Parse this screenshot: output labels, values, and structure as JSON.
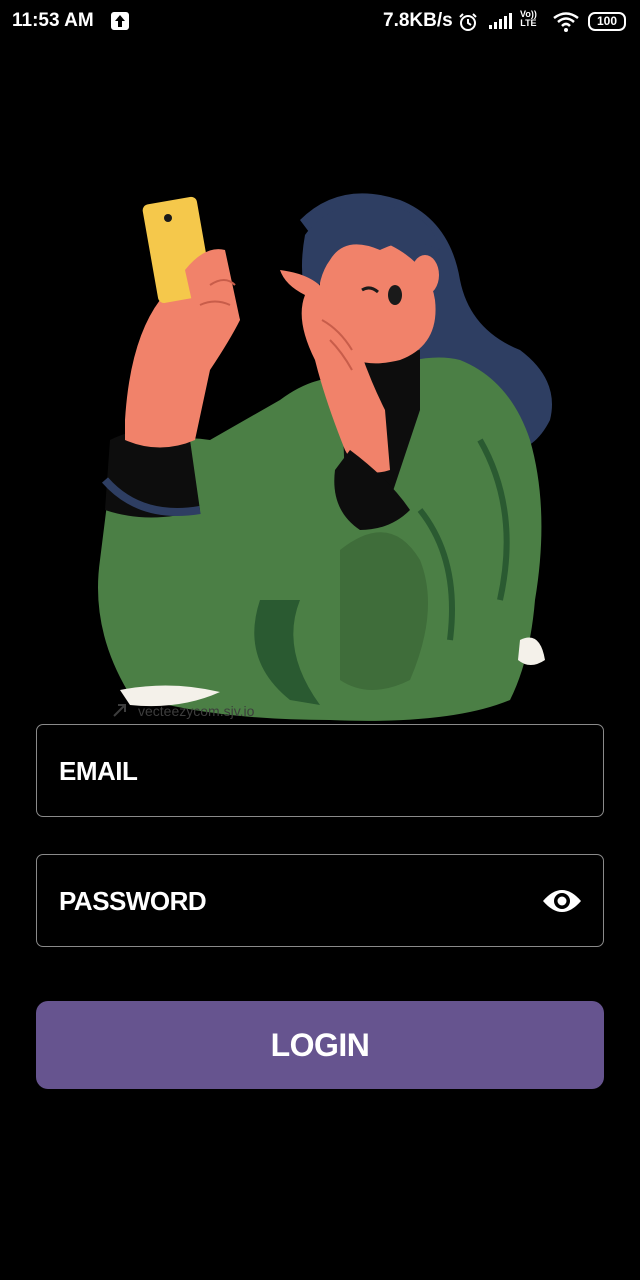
{
  "status_bar": {
    "time": "11:53 AM",
    "network_speed": "7.8KB/s",
    "volte_top": "Vo))",
    "volte_bottom": "LTE",
    "battery": "100",
    "icons": [
      "upload-icon",
      "alarm-icon",
      "signal-icon",
      "volte-icon",
      "wifi-icon",
      "battery-icon"
    ]
  },
  "illustration": {
    "watermark": "vecteezycom.sjv.io"
  },
  "form": {
    "email_placeholder": "EMAIL",
    "password_placeholder": "PASSWORD",
    "login_label": "LOGIN",
    "eye_icon": "eye-icon"
  },
  "colors": {
    "background": "#000000",
    "button": "#66548f",
    "field_border": "#8a8a8a"
  }
}
